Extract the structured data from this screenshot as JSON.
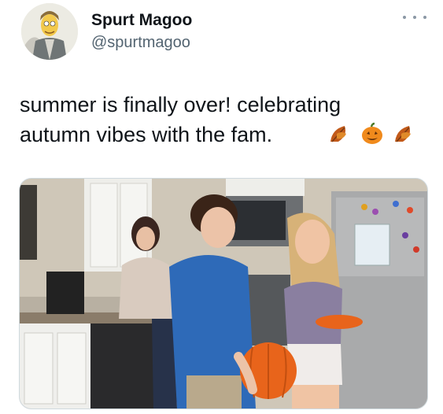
{
  "user": {
    "display_name": "Spurt Magoo",
    "handle": "@spurtmagoo"
  },
  "tweet": {
    "text": "summer is finally over! celebrating\nautumn vibes with the fam.",
    "emojis": [
      "fallen-leaf",
      "jack-o-lantern",
      "fallen-leaf"
    ]
  },
  "icons": {
    "more": "more-horizontal-icon"
  },
  "colors": {
    "primary_text": "#0f1419",
    "secondary_text": "#536471",
    "pumpkin": "#e8641b"
  }
}
